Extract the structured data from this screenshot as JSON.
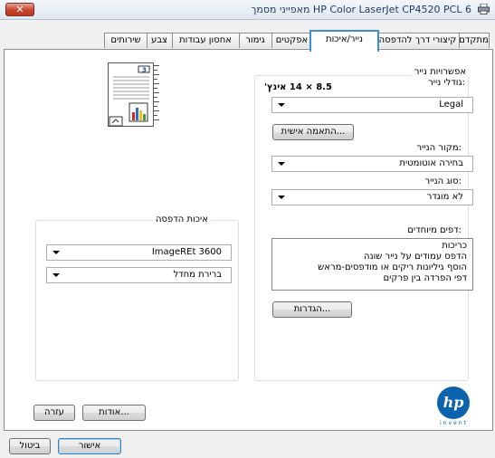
{
  "window": {
    "title": "מאפייני מסמך HP Color LaserJet CP4520 PCL 6",
    "close_label": "✕"
  },
  "tabs": [
    "מתקדם",
    "קיצורי דרך להדפסה",
    "נייר/איכות",
    "אפקטים",
    "גימור",
    "אחסון עבודות",
    "צבע",
    "שירותים"
  ],
  "active_tab": "נייר/איכות",
  "paper_options": {
    "group_label": "אפשרויות נייר",
    "size_label": "גודלי נייר:",
    "size_dimensions": "8.5 × 14 אינץ'",
    "size_value": "Legal",
    "custom_button": "התאמה אישית...",
    "source_label": "מקור הנייר:",
    "source_value": "בחירה אוטומטית",
    "type_label": "סוג הנייר:",
    "type_value": "לא מוגדר"
  },
  "special_pages": {
    "label": "דפים מיוחדים:",
    "items": [
      "כריכות",
      "הדפס עמודים על נייר שונה",
      "הוסף גיליונות ריקים או מודפסים-מראש",
      "דפי הפרדה בין פרקים"
    ],
    "settings_button": "הגדרות..."
  },
  "print_quality": {
    "group_label": "איכות הדפסה",
    "resolution_value": "ImageREt 3600",
    "mode_value": "ברירת מחדל"
  },
  "logo": {
    "text": "hp",
    "tagline": "invent"
  },
  "bottom_buttons": {
    "about": "אודות...",
    "help": "עזרה"
  },
  "dialog_buttons": {
    "ok": "אישור",
    "cancel": "ביטול"
  }
}
